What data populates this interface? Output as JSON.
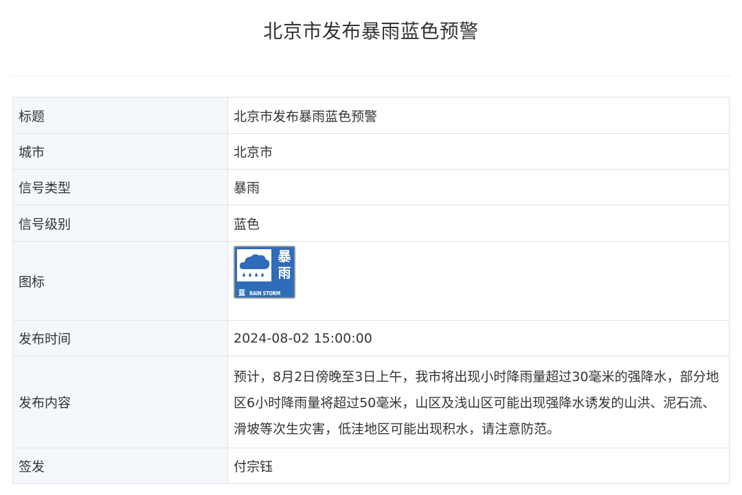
{
  "page": {
    "title": "北京市发布暴雨蓝色预警"
  },
  "table": {
    "rows": {
      "title": {
        "label": "标题",
        "value": "北京市发布暴雨蓝色预警"
      },
      "city": {
        "label": "城市",
        "value": "北京市"
      },
      "signal_type": {
        "label": "信号类型",
        "value": "暴雨"
      },
      "signal_level": {
        "label": "信号级别",
        "value": "蓝色"
      },
      "icon": {
        "label": "图标",
        "icon_name": "rainstorm-blue-warning-icon",
        "icon_chars_top": "暴",
        "icon_chars_bottom": "雨",
        "icon_level_char": "蓝",
        "icon_english": "RAIN STORM",
        "icon_color": "#2f6cb9"
      },
      "publish_time": {
        "label": "发布时间",
        "value": "2024-08-02 15:00:00"
      },
      "content": {
        "label": "发布内容",
        "value": "预计，8月2日傍晚至3日上午，我市将出现小时降雨量超过30毫米的强降水，部分地区6小时降雨量将超过50毫米，山区及浅山区可能出现强降水诱发的山洪、泥石流、滑坡等次生灾害，低洼地区可能出现积水，请注意防范。"
      },
      "issuer": {
        "label": "签发",
        "value": "付宗钰"
      }
    }
  },
  "colors": {
    "label_bg": "#f4f8fc",
    "border": "#e2e2e2",
    "text": "#333333"
  }
}
